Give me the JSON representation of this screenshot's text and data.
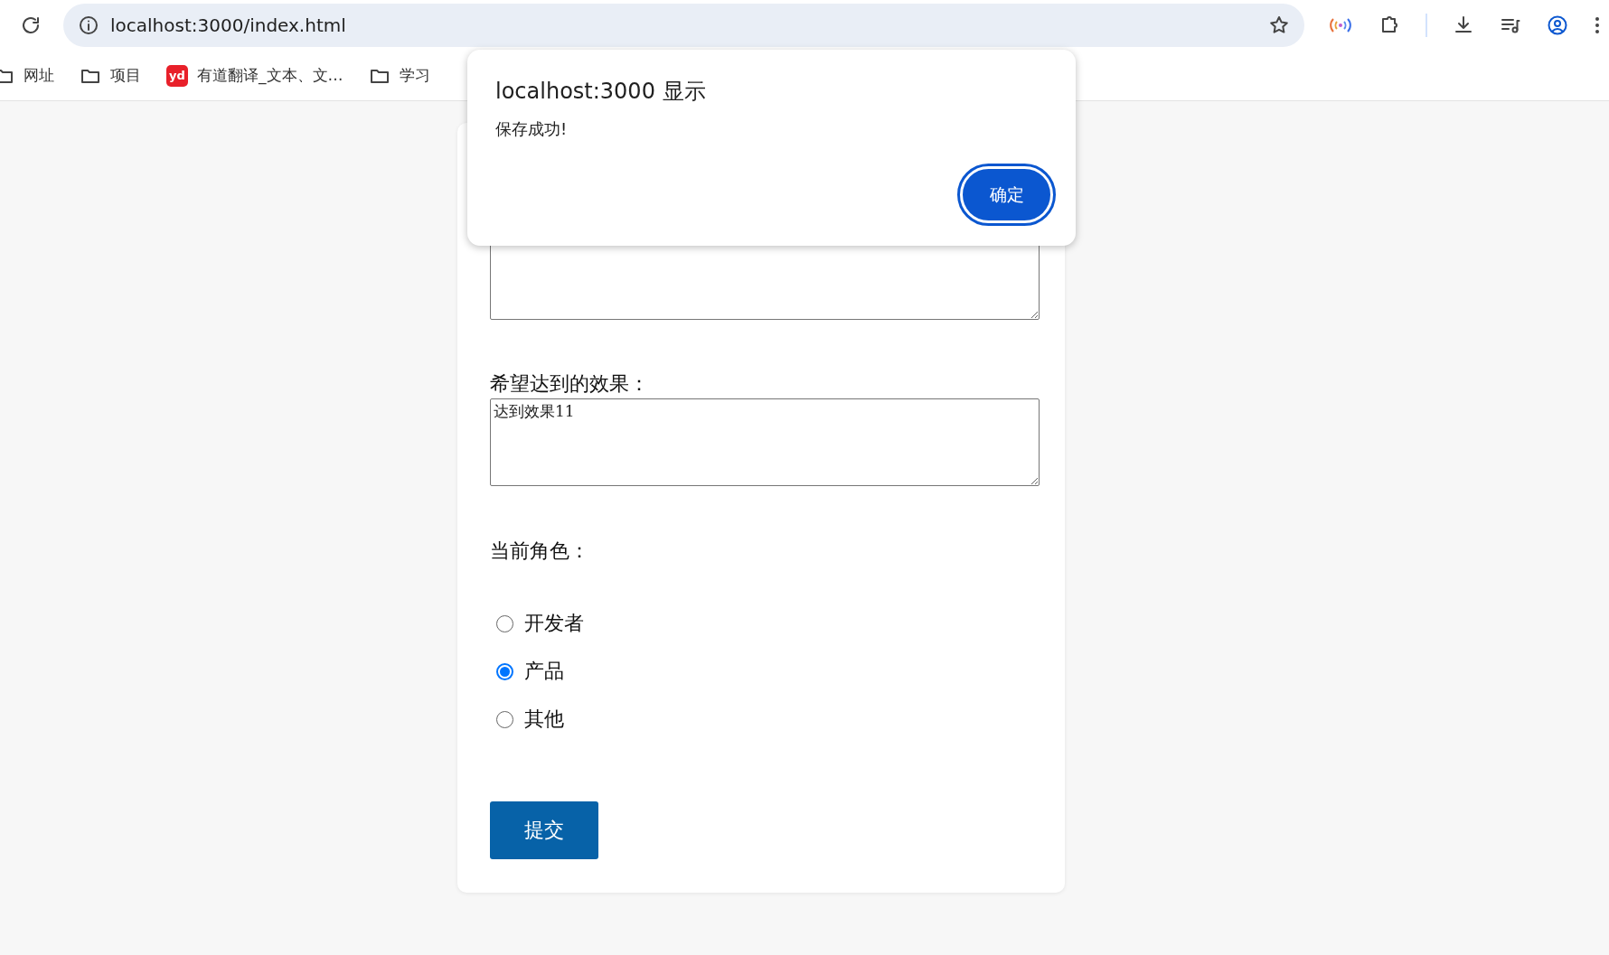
{
  "browser": {
    "url": "localhost:3000/index.html",
    "bookmarks": [
      {
        "kind": "folder",
        "label": "网址"
      },
      {
        "kind": "folder",
        "label": "项目"
      },
      {
        "kind": "app",
        "badge": "yd",
        "label": "有道翻译_文本、文…"
      },
      {
        "kind": "folder",
        "label": "学习"
      }
    ]
  },
  "form": {
    "fields": [
      {
        "kind": "textarea"
      },
      {
        "kind": "textarea",
        "label": "希望达到的效果：",
        "value": "达到效果11"
      }
    ],
    "role": {
      "label": "当前角色：",
      "options": [
        {
          "label": "开发者",
          "selected": false
        },
        {
          "label": "产品",
          "selected": true
        },
        {
          "label": "其他",
          "selected": false
        }
      ]
    },
    "submit": "提交"
  },
  "dialog": {
    "title": "localhost:3000 显示",
    "message": "保存成功!",
    "button": "确定"
  }
}
